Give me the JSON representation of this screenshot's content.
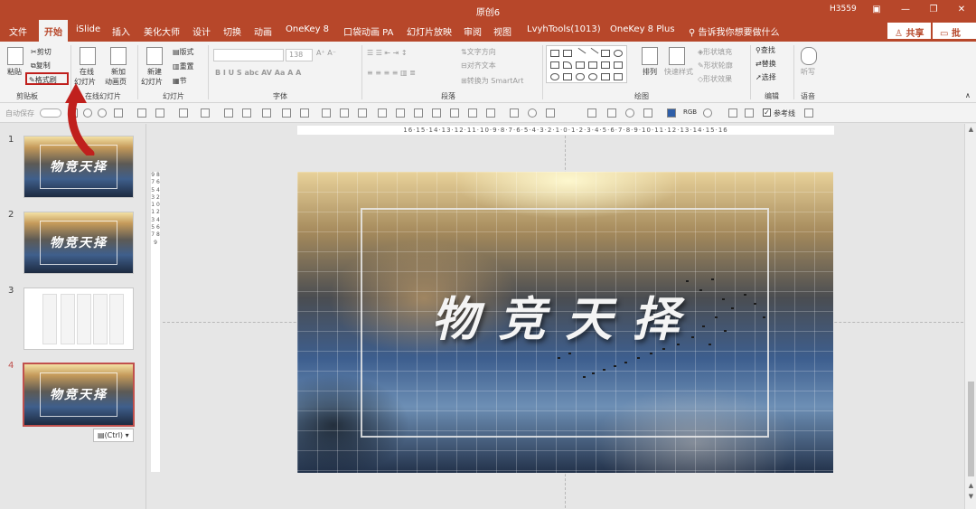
{
  "window": {
    "title": "原创6",
    "user": "H3559"
  },
  "menu_tabs": [
    "文件",
    "开始",
    "iSlide",
    "插入",
    "美化大师",
    "设计",
    "切换",
    "动画",
    "OneKey 8",
    "口袋动画 PA",
    "幻灯片放映",
    "审阅",
    "视图",
    "LvyhTools(1013)",
    "OneKey 8 Plus"
  ],
  "active_tab": "开始",
  "tellme": "告诉我你想要做什么",
  "share_label": "共享",
  "comment_label": "批注",
  "ribbon": {
    "clipboard": {
      "paste": "粘贴",
      "cut": "剪切",
      "copy": "复制",
      "format_painter": "格式刷",
      "group": "剪贴板"
    },
    "online_slides": {
      "online": "在线",
      "online2": "幻灯片",
      "new_anim": "新加",
      "new_anim2": "动画页",
      "group": "在线幻灯片"
    },
    "slides": {
      "new": "新建",
      "new2": "幻灯片",
      "layout": "版式",
      "reset": "重置",
      "section": "节",
      "group": "幻灯片"
    },
    "font": {
      "size": "138",
      "group": "字体"
    },
    "paragraph": {
      "text_direction": "文字方向",
      "align_text": "对齐文本",
      "smartart": "转换为 SmartArt",
      "group": "段落"
    },
    "drawing": {
      "arrange": "排列",
      "quick_styles": "快速样式",
      "fill": "形状填充",
      "outline": "形状轮廓",
      "effects": "形状效果",
      "group": "绘图"
    },
    "editing": {
      "find": "查找",
      "replace": "替换",
      "select": "选择",
      "group": "编辑"
    },
    "voice": {
      "dictate": "听写",
      "group": "语音"
    }
  },
  "qat": {
    "autosave": "自动保存",
    "ruler": "参考线",
    "rgb": "RGB"
  },
  "thumbnails": [
    {
      "num": "1",
      "title": "物竞天择"
    },
    {
      "num": "2",
      "title": "物竞天择"
    },
    {
      "num": "3",
      "title": ""
    },
    {
      "num": "4",
      "title": "物竞天择"
    }
  ],
  "selected_slide": "4",
  "paste_options": "(Ctrl)",
  "ruler": {
    "horizontal": "16·15·14·13·12·11·10·9·8·7·6·5·4·3·2·1·0·1·2·3·4·5·6·7·8·9·10·11·12·13·14·15·16",
    "vertical": "9 8 7 6 5 4 3 2 1 0 1 2 3 4 5 6 7 8 9"
  },
  "slide": {
    "title": "物竞天择"
  },
  "colors": {
    "accent": "#b7472a",
    "annotation": "#c0201d",
    "selected_thumb": "#c0504d"
  }
}
